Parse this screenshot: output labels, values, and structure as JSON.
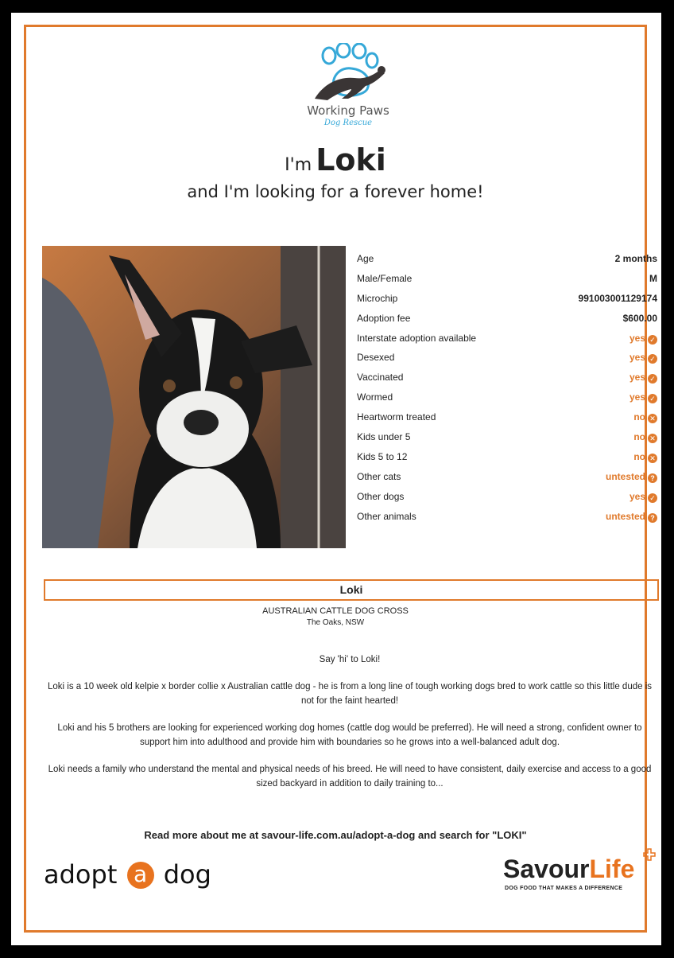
{
  "logo": {
    "line1": "Working Paws",
    "line2": "Dog Rescue"
  },
  "headline": {
    "prefix": "I'm",
    "name": "Loki",
    "subtitle": "and I'm looking for a forever home!"
  },
  "details": [
    {
      "label": "Age",
      "value": "2 months",
      "status": ""
    },
    {
      "label": "Male/Female",
      "value": "M",
      "status": ""
    },
    {
      "label": "Microchip",
      "value": "991003001129174",
      "status": ""
    },
    {
      "label": "Adoption fee",
      "value": "$600.00",
      "status": ""
    },
    {
      "label": "Interstate adoption available",
      "value": "yes",
      "status": "yes"
    },
    {
      "label": "Desexed",
      "value": "yes",
      "status": "yes"
    },
    {
      "label": "Vaccinated",
      "value": "yes",
      "status": "yes"
    },
    {
      "label": "Wormed",
      "value": "yes",
      "status": "yes"
    },
    {
      "label": "Heartworm treated",
      "value": "no",
      "status": "no"
    },
    {
      "label": "Kids under 5",
      "value": "no",
      "status": "no"
    },
    {
      "label": "Kids 5 to 12",
      "value": "no",
      "status": "no"
    },
    {
      "label": "Other cats",
      "value": "untested",
      "status": "untested"
    },
    {
      "label": "Other dogs",
      "value": "yes",
      "status": "yes"
    },
    {
      "label": "Other animals",
      "value": "untested",
      "status": "untested"
    }
  ],
  "status_icons": {
    "yes": "check-circle-icon",
    "no": "x-circle-icon",
    "untested": "question-circle-icon"
  },
  "profile": {
    "name": "Loki",
    "breed": "AUSTRALIAN CATTLE DOG CROSS",
    "location": "The Oaks, NSW",
    "greeting": "Say 'hi' to Loki!",
    "paragraphs": [
      "Loki is a 10 week old kelpie x border collie x Australian cattle dog - he is from a long line of tough working dogs bred to work cattle so this little dude is not for the faint hearted!",
      "Loki and his 5 brothers are looking for experienced working dog homes (cattle dog would be preferred). He will need a strong, confident owner to support him into adulthood and provide him with boundaries so he grows into a well-balanced adult dog.",
      "Loki needs a family who understand the mental and physical needs of his breed. He will need to have consistent, daily exercise and access to a good sized backyard in addition to daily training to..."
    ],
    "read_more": "Read more about me at savour-life.com.au/adopt-a-dog and search for \"LOKI\""
  },
  "footer": {
    "adopt_left": "adopt",
    "adopt_badge": "a",
    "adopt_right": "dog",
    "savour_dark": "Savour",
    "savour_orange": "Life",
    "savour_tagline": "DOG FOOD THAT MAKES A DIFFERENCE"
  },
  "colors": {
    "accent": "#e07a2c",
    "logo_blue": "#35a8d8",
    "text": "#222222"
  }
}
